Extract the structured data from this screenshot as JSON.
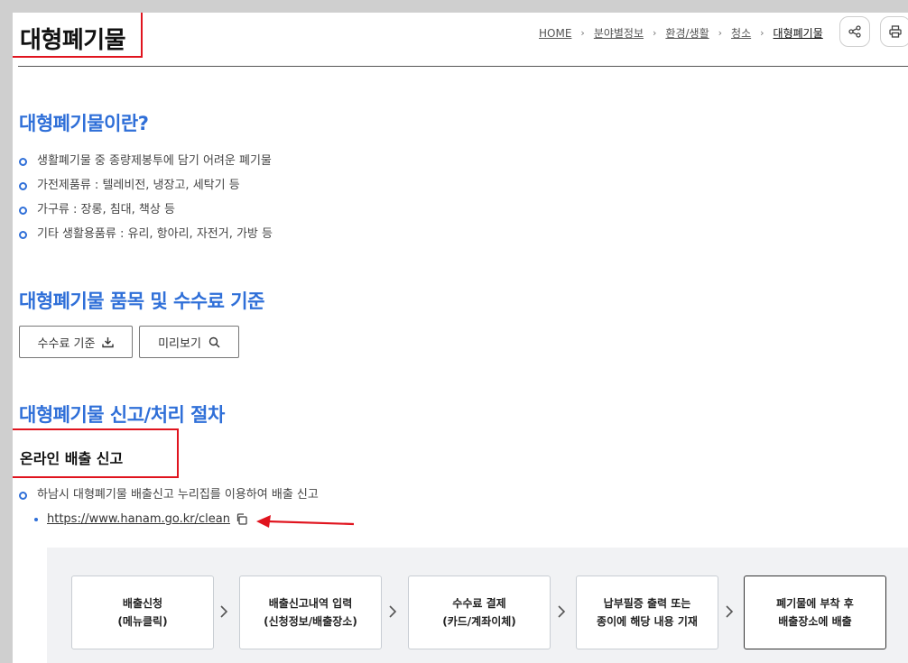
{
  "header": {
    "title": "대형폐기물",
    "breadcrumb": [
      "HOME",
      "분야별정보",
      "환경/생활",
      "청소",
      "대형폐기물"
    ],
    "share_icon": "share-icon",
    "print_icon": "print-icon"
  },
  "section1": {
    "heading": "대형폐기물이란?",
    "items": [
      "생활폐기물 중 종량제봉투에 담기 어려운 폐기물",
      "가전제품류 : 텔레비전, 냉장고, 세탁기 등",
      "가구류 : 장롱, 침대, 책상 등",
      "기타 생활용품류 : 유리, 항아리, 자전거, 가방 등"
    ]
  },
  "section2": {
    "heading": "대형폐기물 품목 및 수수료 기준",
    "download_button": "수수료 기준",
    "preview_button": "미리보기"
  },
  "section3": {
    "heading": "대형폐기물 신고/처리 절차",
    "subheading": "온라인 배출 신고",
    "item": "하남시 대형폐기물 배출신고 누리집를 이용하여 배출 신고",
    "link": "https://www.hanam.go.kr/clean",
    "steps": [
      {
        "line1": "배출신청",
        "line2": "(메뉴클릭)"
      },
      {
        "line1": "배출신고내역 입력",
        "line2": "(신청정보/배출장소)"
      },
      {
        "line1": "수수료 결제",
        "line2": "(카드/계좌이체)"
      },
      {
        "line1": "납부필증 출력 또는",
        "line2": "종이에 해당 내용 기재"
      },
      {
        "line1": "폐기물에 부착 후",
        "line2": "배출장소에 배출"
      }
    ]
  },
  "colors": {
    "accent": "#2f6fd8",
    "highlight": "#e0141e"
  }
}
